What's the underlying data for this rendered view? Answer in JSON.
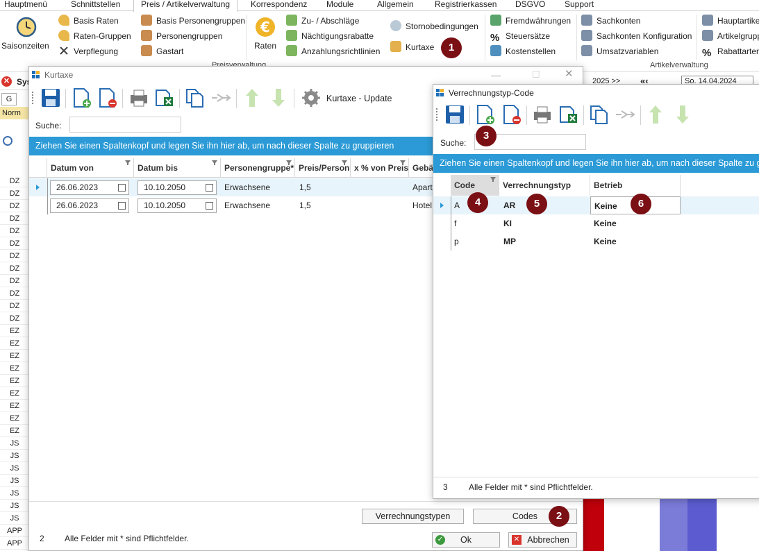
{
  "menubar": {
    "tabs": [
      "Hauptmenü",
      "Schnittstellen",
      "Preis / Artikelverwaltung",
      "Korrespondenz",
      "Module",
      "Allgemein",
      "Registrierkassen",
      "DSGVO",
      "Support"
    ]
  },
  "ribbon": {
    "saisonzeiten": "Saisonzeiten",
    "basis_raten": "Basis Raten",
    "raten_gruppen": "Raten-Gruppen",
    "verpflegung": "Verpflegung",
    "basis_personengruppen": "Basis Personengruppen",
    "personengruppen": "Personengruppen",
    "gastart": "Gastart",
    "raten": "Raten",
    "zu_abschlaege": "Zu- / Abschläge",
    "naechtigungsrabatte": "Nächtigungsrabatte",
    "anzahlungsrichtlinien": "Anzahlungsrichtlinien",
    "stornobedingungen": "Stornobedingungen",
    "kurtaxe": "Kurtaxe",
    "fremdwaehrungen": "Fremdwährungen",
    "steuersaetze": "Steuersätze",
    "kostenstellen": "Kostenstellen",
    "sachkonten": "Sachkonten",
    "sachkonten_konfiguration": "Sachkonten Konfiguration",
    "umsatzvariablen": "Umsatzvariablen",
    "hauptartike": "Hauptartike",
    "artikelgrupp": "Artikelgrupp",
    "rabattarten": "Rabattarten",
    "group_preisverwaltung": "Preisverwaltung",
    "group_artikelverwaltung": "Artikelverwaltung"
  },
  "background": {
    "sys_title": "Sys",
    "col_g": "G",
    "col_norm": "Norm",
    "nav_year": "2025 >>",
    "nav_date": "So. 14.04.2024",
    "rows": [
      "DZ",
      "DZ",
      "DZ",
      "DZ",
      "DZ",
      "DZ",
      "DZ",
      "DZ",
      "DZ",
      "DZ",
      "DZ",
      "DZ",
      "EZ",
      "EZ",
      "EZ",
      "EZ",
      "EZ",
      "EZ",
      "EZ",
      "EZ",
      "EZ",
      "JS",
      "JS",
      "JS",
      "JS",
      "JS",
      "JS",
      "JS",
      "APP",
      "APP"
    ]
  },
  "kurtaxe": {
    "title": "Kurtaxe",
    "update_label": "Kurtaxe - Update",
    "search_label": "Suche:",
    "search_value": "",
    "group_hint": "Ziehen Sie einen Spaltenkopf und legen Sie ihn hier ab, um nach dieser Spalte zu gruppieren",
    "columns": [
      "Datum von",
      "Datum bis",
      "Personengruppe*",
      "Preis/Person",
      "x % von Preis",
      "Gebä"
    ],
    "rows": [
      {
        "datum_von": "26.06.2023",
        "datum_bis": "10.10.2050",
        "personengruppe": "Erwachsene",
        "preis": "1,5",
        "prozent": "",
        "geb": "Apart"
      },
      {
        "datum_von": "26.06.2023",
        "datum_bis": "10.10.2050",
        "personengruppe": "Erwachsene",
        "preis": "1,5",
        "prozent": "",
        "geb": "Hotel"
      }
    ],
    "btn_verrechnungstypen": "Verrechnungstypen",
    "btn_codes": "Codes",
    "btn_ok": "Ok",
    "btn_abbrechen": "Abbrechen",
    "footer_count": "2",
    "footer_note": "Alle Felder mit * sind Pflichtfelder."
  },
  "verrechnung": {
    "title": "Verrechnungstyp-Code",
    "search_label": "Suche:",
    "search_value": "",
    "group_hint": "Ziehen Sie einen Spaltenkopf und legen Sie ihn hier ab, um nach dieser Spalte zu gruppieren",
    "columns": [
      "Code",
      "Verrechnungstyp",
      "Betrieb"
    ],
    "rows": [
      {
        "code": "A",
        "typ": "AR",
        "betrieb": "Keine"
      },
      {
        "code": "f",
        "typ": "KI",
        "betrieb": "Keine"
      },
      {
        "code": "p",
        "typ": "MP",
        "betrieb": "Keine"
      }
    ],
    "footer_count": "3",
    "footer_note": "Alle Felder mit * sind Pflichtfelder."
  },
  "badges": [
    "1",
    "2",
    "3",
    "4",
    "5",
    "6"
  ],
  "colors": {
    "accent_blue": "#2b9ad6",
    "badge_red": "#7a0f14",
    "grid_purple": "#7b7bd8",
    "grid_red": "#c0000b"
  }
}
